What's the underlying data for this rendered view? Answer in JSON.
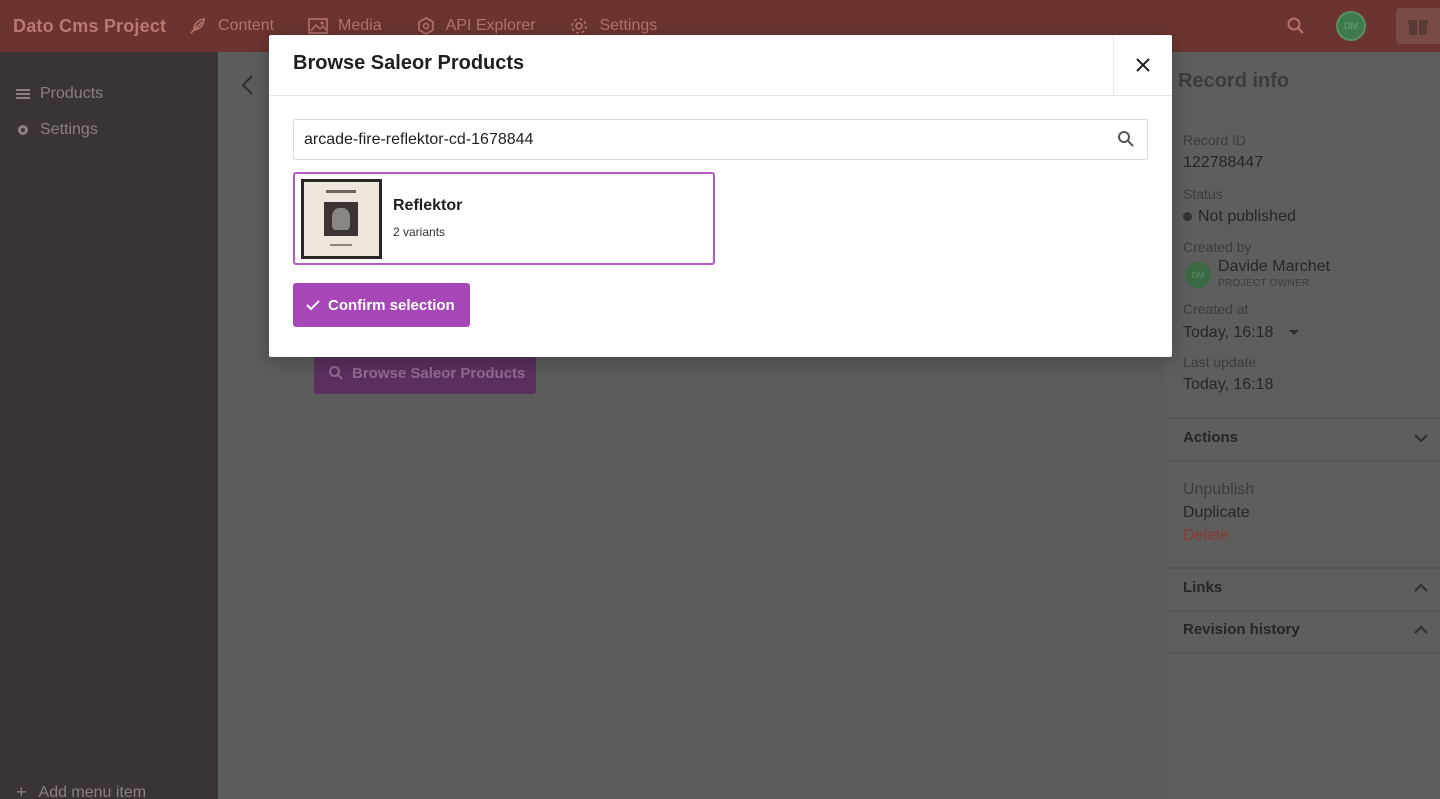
{
  "topbar": {
    "brand": "Dato Cms Project",
    "nav": [
      {
        "label": "Content",
        "icon": "feather-icon"
      },
      {
        "label": "Media",
        "icon": "image-icon"
      },
      {
        "label": "API Explorer",
        "icon": "api-icon"
      },
      {
        "label": "Settings",
        "icon": "gear-icon"
      }
    ],
    "avatar_initials": "DM"
  },
  "sidebar": {
    "items": [
      {
        "label": "Products",
        "icon": "menu-icon"
      },
      {
        "label": "Settings",
        "icon": "gear-icon"
      }
    ],
    "add_label": "Add menu item"
  },
  "main": {
    "browse_button_label": "Browse Saleor Products"
  },
  "modal": {
    "title": "Browse Saleor Products",
    "search_value": "arcade-fire-reflektor-cd-1678844",
    "product": {
      "name": "Reflektor",
      "variants": "2 variants"
    },
    "confirm_label": "Confirm selection"
  },
  "record_info": {
    "title": "Record info",
    "record_id_label": "Record ID",
    "record_id": "122788447",
    "status_label": "Status",
    "status": "Not published",
    "created_by_label": "Created by",
    "creator_initials": "DM",
    "creator_name": "Davide Marchet",
    "creator_role": "PROJECT OWNER",
    "created_at_label": "Created at",
    "created_at": "Today, 16:18",
    "last_update_label": "Last update",
    "last_update": "Today, 16:18",
    "actions_label": "Actions",
    "actions": [
      "Unpublish",
      "Duplicate",
      "Delete"
    ],
    "links_label": "Links",
    "revision_label": "Revision history"
  },
  "colors": {
    "accent": "#a646b7",
    "danger": "#8a3a33"
  }
}
